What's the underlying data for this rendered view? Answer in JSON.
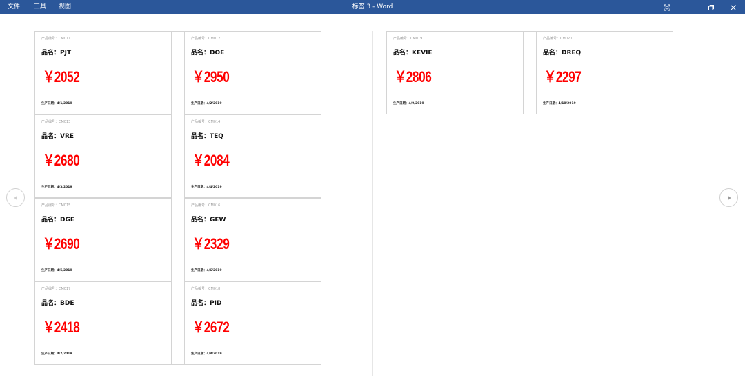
{
  "window": {
    "title": "标签 3 - Word",
    "menu": [
      "文件",
      "工具",
      "视图"
    ],
    "buttons": [
      "fullscreen-icon",
      "minimize-icon",
      "restore-icon",
      "close-icon"
    ]
  },
  "labels": [
    {
      "code": "产品编号：CM011",
      "name": "品名：PJT",
      "price": "￥2052",
      "date": "生产日期：4/1/2019"
    },
    {
      "code": "产品编号：CM012",
      "name": "品名：DOE",
      "price": "￥2950",
      "date": "生产日期：4/2/2019"
    },
    {
      "code": "产品编号：CM013",
      "name": "品名：VRE",
      "price": "￥2680",
      "date": "生产日期：4/3/2019"
    },
    {
      "code": "产品编号：CM014",
      "name": "品名：TEQ",
      "price": "￥2084",
      "date": "生产日期：4/4/2019"
    },
    {
      "code": "产品编号：CM015",
      "name": "品名：DGE",
      "price": "￥2690",
      "date": "生产日期：4/5/2019"
    },
    {
      "code": "产品编号：CM016",
      "name": "品名：GEW",
      "price": "￥2329",
      "date": "生产日期：4/6/2019"
    },
    {
      "code": "产品编号：CM017",
      "name": "品名：BDE",
      "price": "￥2418",
      "date": "生产日期：4/7/2019"
    },
    {
      "code": "产品编号：CM018",
      "name": "品名：PID",
      "price": "￥2672",
      "date": "生产日期：4/8/2019"
    },
    {
      "code": "产品编号：CM019",
      "name": "品名：KEVIE",
      "price": "￥2806",
      "date": "生产日期：4/9/2019"
    },
    {
      "code": "产品编号：CM020",
      "name": "品名：DREQ",
      "price": "￥2297",
      "date": "生产日期：4/10/2019"
    }
  ],
  "colors": {
    "titlebar": "#2b579a",
    "price": "#ff0000",
    "border": "#d4d4d4"
  },
  "navigation": {
    "prev": "prev-page-icon",
    "next": "next-page-icon"
  }
}
